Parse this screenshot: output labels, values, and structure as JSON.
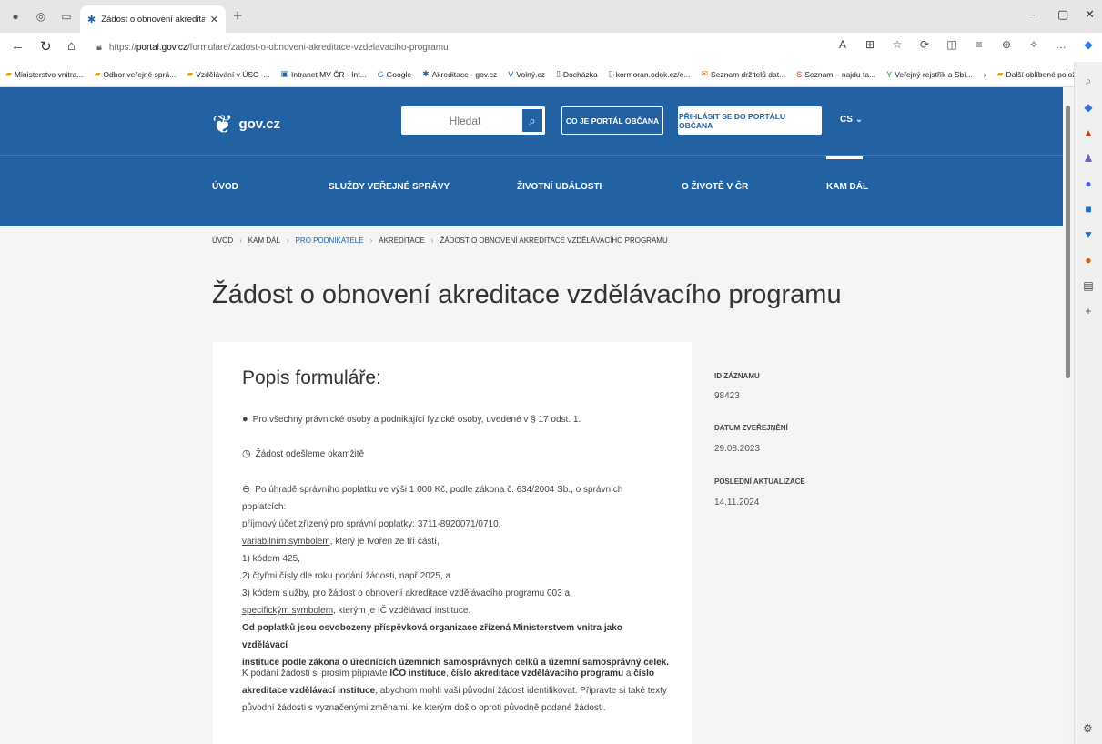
{
  "browser": {
    "tab_title": "Žádost o obnovení akreditace vzd...",
    "url_prefix": "https://",
    "url_domain": "portal.gov.cz",
    "url_path": "/formulare/zadost-o-obnoveni-akreditace-vzdelavaciho-programu",
    "bookmarks": [
      "Ministerstvo vnitra...",
      "Odbor veřejné sprá...",
      "Vzdělávání v ÚSC -...",
      "Intranet MV ČR - Int...",
      "Google",
      "Akreditace - gov.cz",
      "Volný.cz",
      "Docházka",
      "kormoran.odok.cz/e...",
      "Seznam držitelů dat...",
      "Seznam – najdu ta...",
      "Veřejný rejstřík a Sbí..."
    ],
    "bookmarks_more": "Další oblíbené položky"
  },
  "header": {
    "logo": "gov.cz",
    "search_placeholder": "Hledat",
    "btn_about": "CO JE PORTÁL OBČANA",
    "btn_login": "PŘIHLÁSIT SE DO PORTÁLU OBČANA",
    "lang": "CS",
    "menu": [
      "ÚVOD",
      "SLUŽBY VEŘEJNÉ SPRÁVY",
      "ŽIVOTNÍ UDÁLOSTI",
      "O ŽIVOTĚ V ČR",
      "KAM DÁL"
    ]
  },
  "breadcrumb": [
    "ÚVOD",
    "KAM DÁL",
    "PRO PODNIKATELE",
    "AKREDITACE",
    "ŽÁDOST O OBNOVENÍ AKREDITACE VZDĚLÁVACÍHO PROGRAMU"
  ],
  "title": "Žádost o obnovení akreditace vzdělávacího programu",
  "card": {
    "heading": "Popis formuláře:",
    "who": "Pro všechny právnické osoby a podnikající fyzické osoby, uvedené v § 17 odst. 1.",
    "when": "Žádost odešleme okamžitě",
    "fee_1": "Po úhradě správního poplatku ve výši 1 000 Kč, podle zákona č. 634/2004 Sb., o správních",
    "fee_2": "poplatcích:",
    "fee_3": "příjmový účet zřízený pro správní poplatky: 3711-8920071/0710,",
    "fee_4_link": "variabilním symbolem",
    "fee_4": ", který je tvořen ze tří částí,",
    "fee_5": "1) kódem 425,",
    "fee_6": "2) čtyřmi čísly dle roku podání žádosti, např 2025, a",
    "fee_7": "3) kódem služby, pro žádost o obnovení akreditace vzdělávacího programu 003 a",
    "fee_8_link": "specifickým symbolem",
    "fee_8": ", kterým je IČ vzdělávací instituce.",
    "fee_9": "Od poplatků jsou osvobozeny příspěvková organizace zřízená Ministerstvem vnitra jako vzdělávací",
    "fee_10": "instituce podle zákona o úřednících územních samosprávných celků a územní samosprávný celek.",
    "prep_1a": "K podání žádosti si prosím připravte ",
    "prep_1b": "IČO instituce",
    "prep_1c": ", ",
    "prep_1d": "číslo akreditace vzdělávacího programu",
    "prep_1e": " a ",
    "prep_1f": "číslo",
    "prep_2a": "akreditace vzdělávací instituce",
    "prep_2b": ", abychom mohli vaši původní žádost identifikovat. Připravte si také texty",
    "prep_3": "původní žádosti s vyznačenými změnami, ke kterým došlo oproti původně podané žádosti."
  },
  "meta": {
    "id_label": "ID ZÁZNAMU",
    "id_value": "98423",
    "pub_label": "DATUM ZVEŘEJNĚNÍ",
    "pub_value": "29.08.2023",
    "upd_label": "POSLEDNÍ AKTUALIZACE",
    "upd_value": "14.11.2024"
  }
}
